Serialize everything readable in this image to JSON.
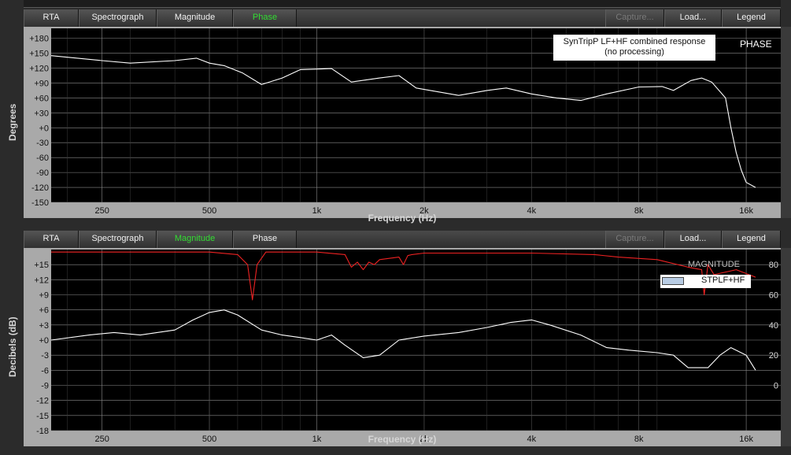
{
  "tabs": [
    "RTA",
    "Spectrograph",
    "Magnitude",
    "Phase",
    "Capture...",
    "Load...",
    "Legend"
  ],
  "phase_pane": {
    "active_tab": "Phase",
    "y_axis_label": "Degrees",
    "x_axis_label": "Frequency (Hz)",
    "note_line1": "SynTripP LF+HF combined response",
    "note_line2": "(no processing)",
    "tag": "PHASE"
  },
  "magnitude_pane": {
    "active_tab": "Magnitude",
    "y_axis_label": "Decibels (dB)",
    "x_axis_label": "Frequency (Hz)",
    "tag": "MAGNITUDE",
    "legend_label": "STPLF+HF"
  },
  "colors": {
    "active_tab": "#33dd33",
    "trace": "#ffffff",
    "coherence": "#ee2222",
    "plot_bg": "#000000",
    "grid": "#8a8a8a"
  },
  "chart_data": [
    {
      "type": "line",
      "name": "phase",
      "xscale": "log",
      "x_ticks": [
        250,
        500,
        1000,
        2000,
        4000,
        8000,
        16000
      ],
      "x_tick_labels": [
        "250",
        "500",
        "1k",
        "2k",
        "4k",
        "8k",
        "16k"
      ],
      "y_ticks": [
        180,
        150,
        120,
        90,
        60,
        30,
        0,
        -30,
        -60,
        -90,
        -120,
        -150
      ],
      "y_tick_labels": [
        "+180",
        "+150",
        "+120",
        "+90",
        "+60",
        "+30",
        "+0",
        "-30",
        "-60",
        "-90",
        "-120",
        "-150"
      ],
      "xlim": [
        180,
        20000
      ],
      "ylim": [
        -150,
        200
      ],
      "xlabel": "Frequency (Hz)",
      "ylabel": "Degrees",
      "grid": true,
      "series": [
        {
          "x": [
            180,
            250,
            300,
            400,
            460,
            500,
            550,
            620,
            700,
            800,
            900,
            1000,
            1100,
            1250,
            1500,
            1700,
            1900,
            2200,
            2500,
            3000,
            3400,
            4000,
            4700,
            5500,
            6500,
            8000,
            9300,
            10000,
            11200,
            12000,
            12800,
            14000,
            14500,
            15000,
            15500,
            16000,
            17000
          ],
          "y": [
            145,
            135,
            130,
            135,
            140,
            130,
            125,
            110,
            87,
            100,
            117,
            118,
            119,
            92,
            100,
            105,
            80,
            72,
            65,
            75,
            80,
            68,
            60,
            55,
            68,
            82,
            83,
            75,
            95,
            100,
            92,
            60,
            0,
            -50,
            -85,
            -110,
            -120
          ]
        }
      ]
    },
    {
      "type": "line",
      "name": "magnitude",
      "xscale": "log",
      "x_ticks": [
        250,
        500,
        1000,
        2000,
        4000,
        8000,
        16000
      ],
      "x_tick_labels": [
        "250",
        "500",
        "1k",
        "2k",
        "4k",
        "8k",
        "16k"
      ],
      "y_ticks": [
        15,
        12,
        9,
        6,
        3,
        0,
        -3,
        -6,
        -9,
        -12,
        -15,
        -18
      ],
      "y_tick_labels": [
        "+15",
        "+12",
        "+9",
        "+6",
        "+3",
        "+0",
        "-3",
        "-6",
        "-9",
        "-12",
        "-15",
        "-18"
      ],
      "xlim": [
        180,
        20000
      ],
      "ylim": [
        -18,
        18
      ],
      "xlabel": "Frequency (Hz)",
      "ylabel": "Decibels (dB)",
      "grid": true,
      "right_axis": {
        "ticks": [
          80,
          60,
          40,
          20,
          0
        ],
        "tick_labels": [
          "80",
          "60",
          "40",
          "20",
          "0"
        ]
      },
      "series": [
        {
          "name": "STPLF+HF",
          "x": [
            180,
            230,
            270,
            320,
            400,
            450,
            500,
            550,
            600,
            700,
            800,
            900,
            1000,
            1100,
            1200,
            1350,
            1500,
            1700,
            2000,
            2500,
            3000,
            3500,
            4000,
            4500,
            5500,
            6500,
            7500,
            9000,
            10000,
            11000,
            12500,
            13500,
            14500,
            16000,
            17000
          ],
          "y": [
            0,
            1,
            1.5,
            1,
            2,
            4,
            5.5,
            6,
            5,
            2,
            1,
            0.5,
            0,
            1,
            -1,
            -3.5,
            -3,
            0,
            0.8,
            1.5,
            2.5,
            3.5,
            4,
            3,
            1,
            -1.5,
            -2,
            -2.5,
            -3,
            -5.5,
            -5.5,
            -3,
            -1.5,
            -3,
            -6
          ]
        },
        {
          "name": "coherence",
          "x": [
            180,
            500,
            600,
            640,
            660,
            680,
            720,
            1000,
            1200,
            1250,
            1300,
            1350,
            1400,
            1450,
            1500,
            1700,
            1750,
            1800,
            1850,
            2000,
            4000,
            6000,
            7000,
            9000,
            11000,
            12000,
            12200,
            12500,
            13000,
            15000,
            17000
          ],
          "y": [
            17.5,
            17.5,
            17,
            15,
            8,
            15,
            17.5,
            17.5,
            17,
            14.5,
            15.5,
            14,
            15.5,
            15,
            16,
            16.5,
            15,
            16.8,
            17,
            17.3,
            17.3,
            17,
            16.5,
            16,
            14.5,
            14,
            9,
            15,
            13,
            14,
            12.5
          ]
        }
      ]
    }
  ]
}
